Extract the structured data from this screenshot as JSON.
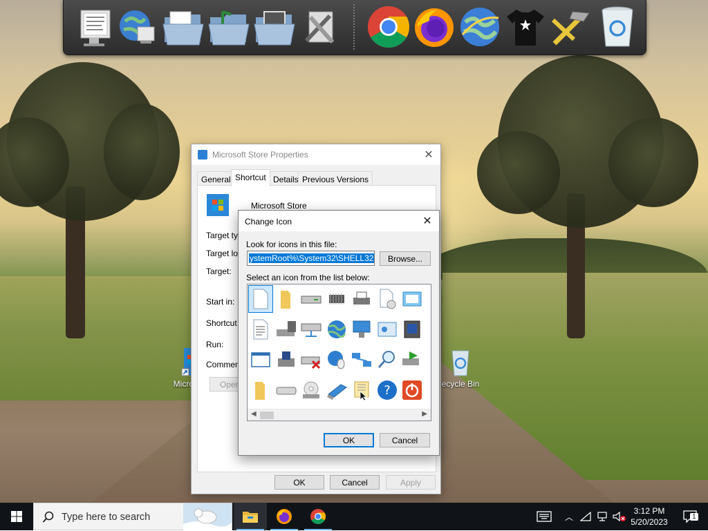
{
  "dock": {
    "items": [
      {
        "name": "system-properties-icon"
      },
      {
        "name": "network-globe-icon"
      },
      {
        "name": "documents-folder-icon"
      },
      {
        "name": "music-folder-icon"
      },
      {
        "name": "pictures-folder-icon"
      },
      {
        "name": "tools-icon"
      },
      {
        "name": "chrome-icon"
      },
      {
        "name": "firefox-icon"
      },
      {
        "name": "internet-explorer-icon"
      },
      {
        "name": "tshirt-icon"
      },
      {
        "name": "hammer-icon"
      },
      {
        "name": "recycle-bin-icon"
      }
    ]
  },
  "desktop": {
    "icons": [
      {
        "label": "Micro Sto",
        "icon": "microsoft-store-icon"
      },
      {
        "label": "ecycle Bin",
        "icon": "recycle-bin-icon"
      }
    ]
  },
  "properties_dialog": {
    "title": "Microsoft Store Properties",
    "tabs": [
      "General",
      "Shortcut",
      "Details",
      "Previous Versions"
    ],
    "active_tab": "Shortcut",
    "app_name": "Microsoft Store",
    "fields": [
      "Target typ",
      "Target loc",
      "Target:",
      "Start in:",
      "Shortcut k",
      "Run:",
      "Comment:"
    ],
    "open_button": "Open",
    "ok_label": "OK",
    "cancel_label": "Cancel",
    "apply_label": "Apply"
  },
  "change_icon_dialog": {
    "title": "Change Icon",
    "look_label": "Look for icons in this file:",
    "path_value": "ystemRoot%\\System32\\SHELL32.dll",
    "browse_label": "Browse...",
    "select_label": "Select an icon from the list below:",
    "ok_label": "OK",
    "cancel_label": "Cancel",
    "icons": [
      "blank-document-icon",
      "folder-icon",
      "drive-icon",
      "chip-icon",
      "printer-icon",
      "clock-document-icon",
      "window-icon",
      "text-document-icon",
      "computer-icon",
      "network-drive-icon",
      "globe-icon",
      "network-computer-icon",
      "control-panel-icon",
      "speaker-window-icon",
      "blank-window-icon",
      "floppy-drive-icon",
      "disconnected-drive-icon",
      "world-mouse-icon",
      "network-connections-icon",
      "search-icon",
      "green-arrow-icon",
      "open-folder-icon",
      "hard-drive-icon",
      "cd-drive-icon",
      "monitor-icon",
      "keyboard-hand-icon",
      "help-icon",
      "power-icon"
    ],
    "selected_index": 0
  },
  "taskbar": {
    "search_placeholder": "Type here to search",
    "time": "3:12 PM",
    "date": "5/20/2023",
    "notification_count": "1",
    "apps": [
      "file-explorer-icon",
      "firefox-icon",
      "chrome-icon"
    ]
  }
}
